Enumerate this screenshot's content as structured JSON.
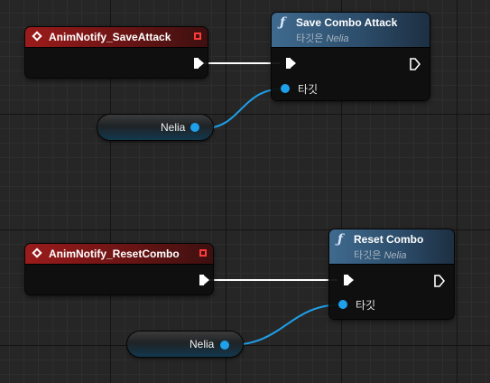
{
  "event_nodes": [
    {
      "title": "AnimNotify_SaveAttack"
    },
    {
      "title": "AnimNotify_ResetCombo"
    }
  ],
  "function_nodes": [
    {
      "title": "Save Combo Attack",
      "target_prefix": "타깃은",
      "target_name": "Nelia",
      "target_pin_label": "타깃"
    },
    {
      "title": "Reset Combo",
      "target_prefix": "타깃은",
      "target_name": "Nelia",
      "target_pin_label": "타깃"
    }
  ],
  "variable_nodes": [
    {
      "label": "Nelia"
    },
    {
      "label": "Nelia"
    }
  ],
  "colors": {
    "exec_wire": "#ffffff",
    "object_wire": "#1ea0ea",
    "event_header": "#9b1b1b",
    "function_header": "#3f6a8e",
    "delegate_pin": "#ff3b3b"
  },
  "icons": {
    "event": "diamond-event-icon",
    "function": "function-f-icon",
    "delegate": "delegate-square-icon",
    "exec": "exec-arrow-icon",
    "object": "object-pin-icon"
  }
}
